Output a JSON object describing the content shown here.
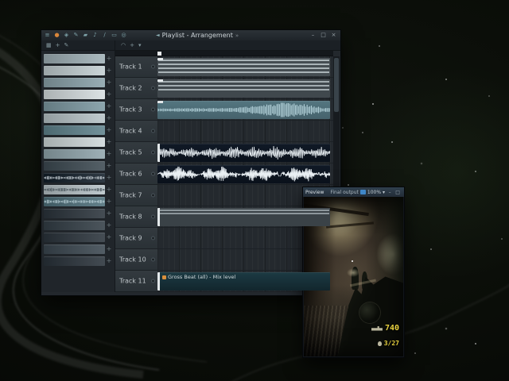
{
  "fl_window": {
    "titlebar": {
      "title": "Playlist - Arrangement",
      "chevron": "»",
      "speaker_glyph": "◄",
      "icons": [
        {
          "name": "menu-icon",
          "glyph": "≡"
        },
        {
          "name": "record-icon",
          "glyph": "●"
        },
        {
          "name": "snap-icon",
          "glyph": "◈"
        },
        {
          "name": "pencil-icon",
          "glyph": "✎"
        },
        {
          "name": "brush-icon",
          "glyph": "▰"
        },
        {
          "name": "mute-tool-icon",
          "glyph": "♪"
        },
        {
          "name": "slice-tool-icon",
          "glyph": "∕"
        },
        {
          "name": "select-tool-icon",
          "glyph": "▭"
        },
        {
          "name": "zoom-tool-icon",
          "glyph": "◎"
        }
      ],
      "controls": [
        {
          "name": "minimize-button",
          "glyph": "–"
        },
        {
          "name": "maximize-button",
          "glyph": "□"
        },
        {
          "name": "close-button",
          "glyph": "×"
        }
      ]
    },
    "toolbar": {
      "picker_icons": [
        {
          "name": "picker-grid-icon",
          "glyph": "▦"
        },
        {
          "name": "picker-add-icon",
          "glyph": "+"
        },
        {
          "name": "picker-draw-icon",
          "glyph": "✎"
        }
      ],
      "main_icons": [
        {
          "name": "magnet-icon",
          "glyph": "◠"
        },
        {
          "name": "pattern-add-icon",
          "glyph": "+"
        },
        {
          "name": "marker-icon",
          "glyph": "▾"
        }
      ]
    },
    "picker": {
      "add_glyph": "+"
    },
    "tracks": [
      {
        "name": "Track 1"
      },
      {
        "name": "Track 2"
      },
      {
        "name": "Track 3"
      },
      {
        "name": "Track 4"
      },
      {
        "name": "Track 5"
      },
      {
        "name": "Track 6"
      },
      {
        "name": "Track 7"
      },
      {
        "name": "Track 8"
      },
      {
        "name": "Track 9"
      },
      {
        "name": "Track 10"
      },
      {
        "name": "Track 11",
        "clip_label": "Gross Beat (all) - Mix level"
      }
    ]
  },
  "preview_window": {
    "titlebar": {
      "left_title": "Preview",
      "center_title": "Final output",
      "zoom_value": "100%",
      "zoom_chevron": "▾",
      "controls": [
        {
          "name": "minimize-button",
          "glyph": "–"
        },
        {
          "name": "maximize-button",
          "glyph": "□"
        },
        {
          "name": "close-button",
          "glyph": "×"
        }
      ]
    },
    "hud": {
      "ammo": "740",
      "reserve": "3/27"
    }
  },
  "theme": {
    "accent_teal": "#6fa7b0",
    "clip_navy": "#0e1823",
    "clip_teal": "#527481",
    "hud_yellow": "#e8d23f"
  }
}
